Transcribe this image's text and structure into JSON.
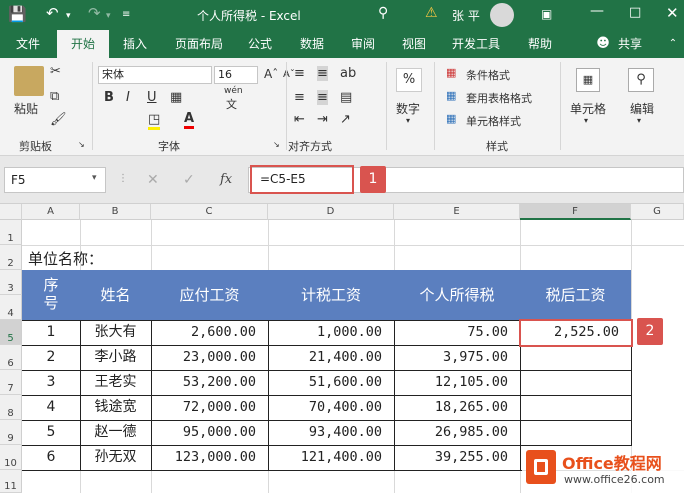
{
  "titlebar": {
    "file_title": "个人所得税 - Excel",
    "user": "张 平"
  },
  "tabs": [
    "文件",
    "开始",
    "插入",
    "页面布局",
    "公式",
    "数据",
    "审阅",
    "视图",
    "开发工具",
    "帮助"
  ],
  "share": "共享",
  "ribbon": {
    "paste": "粘贴",
    "clipboard": "剪贴板",
    "font_name": "宋体",
    "font_size": "16",
    "font_group": "字体",
    "align_group": "对齐方式",
    "number": "数字",
    "cond_format": "条件格式",
    "table_format": "套用表格格式",
    "cell_style": "单元格样式",
    "styles_group": "样式",
    "cells": "单元格",
    "editing": "编辑",
    "bold": "B",
    "italic": "I",
    "underline": "U",
    "wen": "wén",
    "wen2": "文"
  },
  "formula_bar": {
    "name_box": "F5",
    "formula": "=C5-E5",
    "fx": "fx"
  },
  "badges": [
    "1",
    "2"
  ],
  "columns": [
    "A",
    "B",
    "C",
    "D",
    "E",
    "F",
    "G"
  ],
  "rows": [
    "1",
    "2",
    "3",
    "4",
    "5",
    "6",
    "7",
    "8",
    "9",
    "10",
    "11"
  ],
  "sheet": {
    "unit_label": "单位名称：",
    "headers": {
      "seq_a": "序",
      "seq_b": "号",
      "name": "姓名",
      "payable": "应付工资",
      "taxable": "计税工资",
      "tax": "个人所得税",
      "after": "税后工资"
    },
    "data": [
      [
        "1",
        "张大有",
        "2,600.00",
        "1,000.00",
        "75.00",
        "2,525.00"
      ],
      [
        "2",
        "李小路",
        "23,000.00",
        "21,400.00",
        "3,975.00",
        ""
      ],
      [
        "3",
        "王老实",
        "53,200.00",
        "51,600.00",
        "12,105.00",
        ""
      ],
      [
        "4",
        "钱途宽",
        "72,000.00",
        "70,400.00",
        "18,265.00",
        ""
      ],
      [
        "5",
        "赵一德",
        "95,000.00",
        "93,400.00",
        "26,985.00",
        ""
      ],
      [
        "6",
        "孙无双",
        "123,000.00",
        "121,400.00",
        "39,255.00",
        ""
      ]
    ]
  },
  "watermark": {
    "brand": "Office教程网",
    "url": "www.office26.com"
  },
  "colors": {
    "excel_green": "#217346",
    "header_blue": "#5b7fbf",
    "highlight_red": "#d9544f",
    "logo_orange": "#e8501c"
  }
}
